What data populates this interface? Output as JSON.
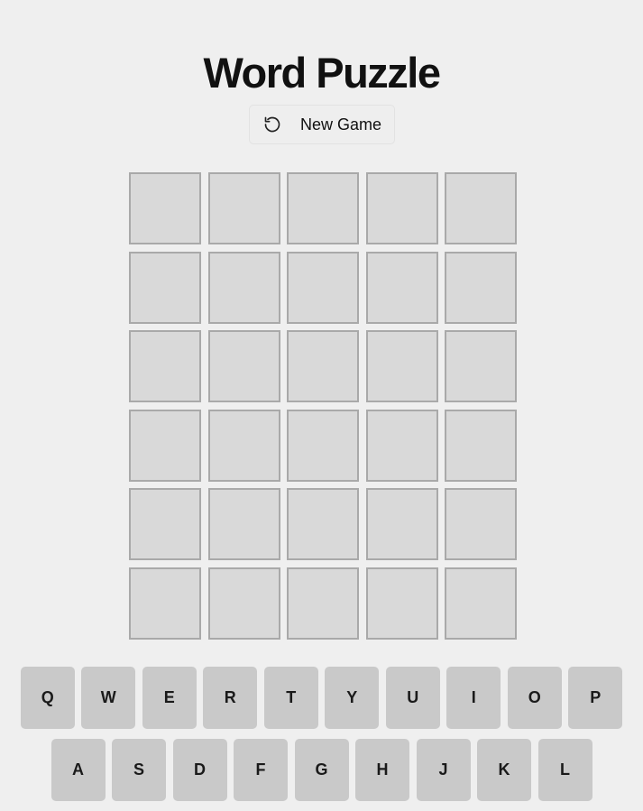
{
  "app": {
    "title": "Word Puzzle"
  },
  "controls": {
    "new_game_label": "New Game",
    "new_game_icon": "restart-icon"
  },
  "board": {
    "rows": [
      [
        "",
        "",
        "",
        "",
        ""
      ],
      [
        "",
        "",
        "",
        "",
        ""
      ],
      [
        "",
        "",
        "",
        "",
        ""
      ],
      [
        "",
        "",
        "",
        "",
        ""
      ],
      [
        "",
        "",
        "",
        "",
        ""
      ],
      [
        "",
        "",
        "",
        "",
        ""
      ]
    ]
  },
  "keyboard": {
    "rows": [
      [
        "Q",
        "W",
        "E",
        "R",
        "T",
        "Y",
        "U",
        "I",
        "O",
        "P"
      ],
      [
        "A",
        "S",
        "D",
        "F",
        "G",
        "H",
        "J",
        "K",
        "L"
      ]
    ]
  },
  "colors": {
    "background": "#efefef",
    "tile_fill": "#d9d9d9",
    "tile_border": "#a9a9a9",
    "key_fill": "#c9c9c9"
  }
}
